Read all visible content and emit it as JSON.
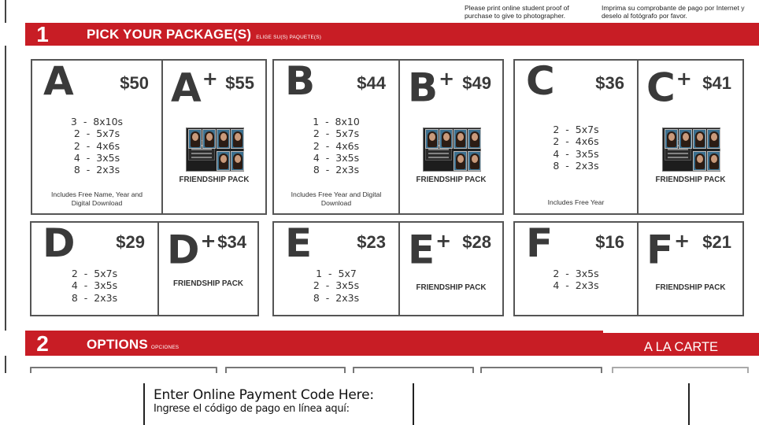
{
  "header_notice": {
    "en": "Please print online student proof of purchase to give to photographer.",
    "es": "Imprima su comprobante de pago por Internet y deselo al fotógrafo por favor."
  },
  "section1": {
    "number": "1",
    "title": "PICK YOUR PACKAGE(S)",
    "subtitle": "ELIGE SU(S) PAQUETE(S)"
  },
  "packages_row1": [
    {
      "base": {
        "letter": "A",
        "price": "$50",
        "lines": [
          "3  -  8x10s",
          "2  -  5x7s",
          "2  -  4x6s",
          "4  -  3x5s",
          "8  -  2x3s"
        ],
        "note": "Includes Free Name, Year and Digital Download"
      },
      "plus": {
        "letter": "A",
        "plus_mark": "+",
        "price": "$55",
        "pack": "FRIENDSHIP PACK"
      }
    },
    {
      "base": {
        "letter": "B",
        "price": "$44",
        "lines": [
          "1  -  8x10",
          "2  -  5x7s",
          "2  -  4x6s",
          "4  -  3x5s",
          "8  -  2x3s"
        ],
        "note": "Includes Free Year and Digital Download"
      },
      "plus": {
        "letter": "B",
        "plus_mark": "+",
        "price": "$49",
        "pack": "FRIENDSHIP PACK"
      }
    },
    {
      "base": {
        "letter": "C",
        "price": "$36",
        "lines": [
          "2  -  5x7s",
          "2  -  4x6s",
          "4  -  3x5s",
          "8  -  2x3s"
        ],
        "note": "Includes Free Year"
      },
      "plus": {
        "letter": "C",
        "plus_mark": "+",
        "price": "$41",
        "pack": "FRIENDSHIP PACK"
      }
    }
  ],
  "packages_row2": [
    {
      "base": {
        "letter": "D",
        "price": "$29",
        "lines": [
          "2  -  5x7s",
          "4  -  3x5s",
          "8  -  2x3s"
        ]
      },
      "plus": {
        "letter": "D",
        "plus_mark": "+",
        "price": "$34",
        "pack": "FRIENDSHIP PACK"
      }
    },
    {
      "base": {
        "letter": "E",
        "price": "$23",
        "lines": [
          "1  -  5x7",
          "2  -  3x5s",
          "8  -  2x3s"
        ]
      },
      "plus": {
        "letter": "E",
        "plus_mark": "+",
        "price": "$28",
        "pack": "FRIENDSHIP PACK"
      }
    },
    {
      "base": {
        "letter": "F",
        "price": "$16",
        "lines": [
          "2  -  3x5s",
          "4  -  2x3s"
        ]
      },
      "plus": {
        "letter": "F",
        "plus_mark": "+",
        "price": "$21",
        "pack": "FRIENDSHIP PACK"
      }
    }
  ],
  "section2": {
    "number": "2",
    "title": "OPTIONS",
    "subtitle": "OPCIONES",
    "a_la_carte": "A LA CARTE"
  },
  "payment": {
    "label_en": "Enter Online Payment Code Here:",
    "label_es": "Ingrese el código de pago en línea aquí:"
  },
  "colors": {
    "brand_red": "#c81d25",
    "border_gray": "#555555"
  }
}
